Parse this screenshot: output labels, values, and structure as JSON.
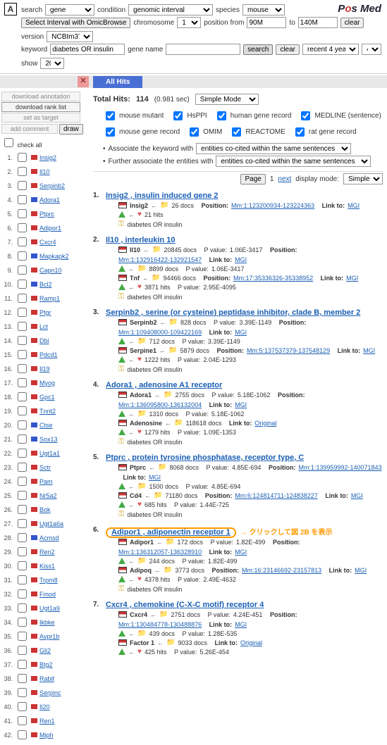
{
  "letter": "A",
  "logo": "Pos Med",
  "header": {
    "search_lbl": "search",
    "search_sel": "gene",
    "cond_lbl": "condition",
    "cond_sel": "genomic interval",
    "species_lbl": "species",
    "species_sel": "mouse",
    "sel_interval_btn": "Select Interval with OmicBrowse",
    "chrom_lbl": "chromosome",
    "chrom_sel": "1",
    "pos_from_lbl": "position from",
    "pos_from": "90M",
    "to_lbl": "to",
    "pos_to": "140M",
    "clear1": "clear",
    "version_lbl": "version",
    "version_sel": "NCBIm37",
    "kw_lbl": "keyword",
    "kw_val": "diabetes OR insulin",
    "gene_lbl": "gene name",
    "gene_val": "",
    "search_btn": "search",
    "clear2": "clear",
    "recent_sel": "recent 4 years",
    "recent_n": "4",
    "show_lbl": "show",
    "show_n": "20"
  },
  "tab": "All Hits",
  "sidebar": {
    "dl_anno": "download annotation",
    "dl_rank": "download rank list",
    "set_target": "set as target",
    "add_comment": "add comment",
    "draw_btn": "draw",
    "check_all": "check all",
    "items": [
      {
        "n": "1.",
        "c": "red",
        "t": "Insig2"
      },
      {
        "n": "2.",
        "c": "red",
        "t": "Il10"
      },
      {
        "n": "3.",
        "c": "red",
        "t": "Serpinb2"
      },
      {
        "n": "4.",
        "c": "blue",
        "t": "Adora1"
      },
      {
        "n": "5.",
        "c": "red",
        "t": "Ptprc"
      },
      {
        "n": "6.",
        "c": "red",
        "t": "Adipor1"
      },
      {
        "n": "7.",
        "c": "red",
        "t": "Cxcr4"
      },
      {
        "n": "8.",
        "c": "blue",
        "t": "Mapkapk2"
      },
      {
        "n": "9.",
        "c": "red",
        "t": "Capn10"
      },
      {
        "n": "10.",
        "c": "blue",
        "t": "Bcl2"
      },
      {
        "n": "11.",
        "c": "red",
        "t": "Ramp1"
      },
      {
        "n": "12.",
        "c": "red",
        "t": "Ptgr"
      },
      {
        "n": "13.",
        "c": "red",
        "t": "Lct"
      },
      {
        "n": "14.",
        "c": "red",
        "t": "Dbi"
      },
      {
        "n": "15.",
        "c": "red",
        "t": "Pdcd1"
      },
      {
        "n": "16.",
        "c": "red",
        "t": "Il19"
      },
      {
        "n": "17.",
        "c": "red",
        "t": "Myog"
      },
      {
        "n": "18.",
        "c": "red",
        "t": "Gpc1"
      },
      {
        "n": "19.",
        "c": "red",
        "t": "Tnnt2"
      },
      {
        "n": "20.",
        "c": "blue",
        "t": "Ctse"
      },
      {
        "n": "21.",
        "c": "blue",
        "t": "Sox13"
      },
      {
        "n": "22.",
        "c": "red",
        "t": "Ugt1a1"
      },
      {
        "n": "23.",
        "c": "red",
        "t": "Sctr"
      },
      {
        "n": "24.",
        "c": "red",
        "t": "Pam"
      },
      {
        "n": "25.",
        "c": "red",
        "t": "Nr5a2"
      },
      {
        "n": "26.",
        "c": "red",
        "t": "Bok"
      },
      {
        "n": "27.",
        "c": "red",
        "t": "Ugt1a6a"
      },
      {
        "n": "28.",
        "c": "blue",
        "t": "Acmsd"
      },
      {
        "n": "29.",
        "c": "red",
        "t": "Ren2"
      },
      {
        "n": "30.",
        "c": "red",
        "t": "Kiss1"
      },
      {
        "n": "31.",
        "c": "red",
        "t": "Trpm8"
      },
      {
        "n": "32.",
        "c": "red",
        "t": "Fmod"
      },
      {
        "n": "33.",
        "c": "red",
        "t": "Ugt1a9"
      },
      {
        "n": "34.",
        "c": "red",
        "t": "Ikbke"
      },
      {
        "n": "35.",
        "c": "red",
        "t": "Avpr1b"
      },
      {
        "n": "36.",
        "c": "red",
        "t": "Gli2"
      },
      {
        "n": "37.",
        "c": "red",
        "t": "Btg2"
      },
      {
        "n": "38.",
        "c": "red",
        "t": "Rabif"
      },
      {
        "n": "39.",
        "c": "red",
        "t": "Serpinc"
      },
      {
        "n": "40.",
        "c": "red",
        "t": "Il20"
      },
      {
        "n": "41.",
        "c": "red",
        "t": "Ren1"
      },
      {
        "n": "42.",
        "c": "red",
        "t": "Miph"
      }
    ]
  },
  "content": {
    "total_lbl": "Total Hits:",
    "total_n": "114",
    "time": "(0.981 sec)",
    "mode_sel": "Simple Mode",
    "cks": [
      "mouse mutant",
      "HsPPI",
      "human gene record",
      "MEDLINE (sentence)",
      "mouse gene record",
      "OMIM",
      "REACTOME",
      "rat gene record"
    ],
    "assoc1_pre": "Associate the keyword with",
    "assoc1_sel": "entities co-cited within the same sentences",
    "assoc2_pre": "Further associate the entities with",
    "assoc2_sel": "entities co-cited within the same sentences",
    "page_lbl": "Page",
    "page_n": "1",
    "next": "next",
    "disp_lbl": "display mode:",
    "disp_sel": "Simple",
    "lbl_docs": "docs",
    "lbl_pval": "P value:",
    "lbl_pos": "Position:",
    "lbl_link": "Link to:",
    "lbl_hits": "hits",
    "lbl_dor": "diabetes OR insulin",
    "mgi": "MGI",
    "orig": "Original",
    "hits": [
      {
        "n": "1.",
        "title": "Insig2 , insulin induced gene 2",
        "lines": [
          {
            "e": "Insig2",
            "d": "26",
            "pos": "Mm:1:123200934-123224363"
          },
          {
            "up": true,
            "hits": "21"
          },
          {
            "key": true
          }
        ]
      },
      {
        "n": "2.",
        "title": "Il10 , interleukin 10",
        "lines": [
          {
            "e": "Il10",
            "d": "20845",
            "pv": "1.06E-3417",
            "pos": "Mm:1:132916422-132921547"
          },
          {
            "up": true,
            "d": "8899",
            "pv": "1.06E-3417"
          },
          {
            "e": "Tnf",
            "d": "94466",
            "pos": "Mm:17:35336326-35338952"
          },
          {
            "up": true,
            "hits": "3871",
            "pv": "2.95E-4095"
          },
          {
            "key": true
          }
        ]
      },
      {
        "n": "3.",
        "title": "Serpinb2 , serine (or cysteine) peptidase inhibitor, clade B, member 2",
        "lines": [
          {
            "e": "Serpinb2",
            "d": "828",
            "pv": "3.39E-1149",
            "pos": "Mm:1:109408000-109422169"
          },
          {
            "up": true,
            "d": "712",
            "pv": "3.39E-1149"
          },
          {
            "e": "Serpine1",
            "d": "5879",
            "pos": "Mm:5:137537379-137548129"
          },
          {
            "up": true,
            "hits": "1222",
            "pv": "2.04E-1293"
          },
          {
            "key": true
          }
        ]
      },
      {
        "n": "4.",
        "title": "Adora1 , adenosine A1 receptor",
        "lines": [
          {
            "e": "Adora1",
            "d": "2755",
            "pv": "5.18E-1062",
            "pos": "Mm:1:136095800-136132004"
          },
          {
            "up": true,
            "d": "1310",
            "pv": "5.18E-1062"
          },
          {
            "e": "Adenosine",
            "d": "118618",
            "orig": true
          },
          {
            "up": true,
            "hits": "1279",
            "pv": "1.09E-1353"
          },
          {
            "key": true
          }
        ]
      },
      {
        "n": "5.",
        "title": "Ptprc , protein tyrosine phosphatase, receptor type, C",
        "lines": [
          {
            "e": "Ptprc",
            "d": "8068",
            "pv": "4.85E-694",
            "pos": "Mm:1:139959992-140071843"
          },
          {
            "up": true,
            "d": "1500",
            "pv": "4.85E-694"
          },
          {
            "e": "Cd4",
            "d": "71180",
            "pos": "Mm:6:124814711-124838227"
          },
          {
            "up": true,
            "hits": "685",
            "pv": "1.44E-725"
          },
          {
            "key": true
          }
        ]
      },
      {
        "n": "6.",
        "title": "Adipor1 , adiponectin receptor 1",
        "circled": true,
        "note": "クリックして図 2B を表示",
        "lines": [
          {
            "e": "Adipor1",
            "d": "172",
            "pv": "1.82E-499",
            "pos": "Mm:1:136312057-136328910"
          },
          {
            "up": true,
            "d": "244",
            "pv": "1.82E-499"
          },
          {
            "e": "Adipoq",
            "d": "3773",
            "pos": "Mm:16:23146692-23157813"
          },
          {
            "up": true,
            "hits": "4378",
            "pv": "2.49E-4632"
          },
          {
            "key": true
          }
        ]
      },
      {
        "n": "7.",
        "title": "Cxcr4 , chemokine (C-X-C motif) receptor 4",
        "lines": [
          {
            "e": "Cxcr4",
            "d": "2751",
            "pv": "4.24E-451",
            "pos": "Mm:1:130484778-130488876"
          },
          {
            "up": true,
            "d": "439",
            "pv": "1.28E-535"
          },
          {
            "e": "Factor 1",
            "d": "9033",
            "orig": true
          },
          {
            "up": true,
            "hits": "425",
            "pv": "5.26E-454"
          }
        ]
      }
    ]
  }
}
